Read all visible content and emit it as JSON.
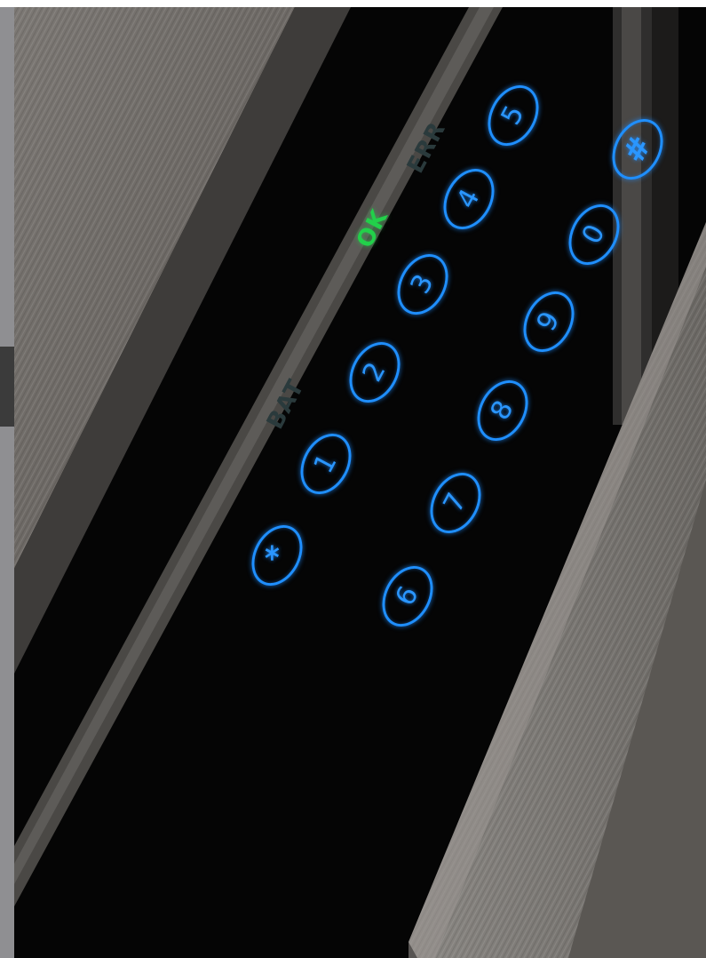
{
  "indicators": {
    "bat": "BAT",
    "ok": "OK",
    "err": "ERR"
  },
  "keypad": {
    "row_upper": [
      "*",
      "1",
      "2",
      "3",
      "4",
      "5"
    ],
    "row_lower": [
      "6",
      "7",
      "8",
      "9",
      "0",
      "#"
    ]
  },
  "colors": {
    "key_glow": "#1f8fff",
    "ok_indicator": "#22d04a",
    "glass_panel": "#050505",
    "brushed_metal": "#6e6b67"
  }
}
